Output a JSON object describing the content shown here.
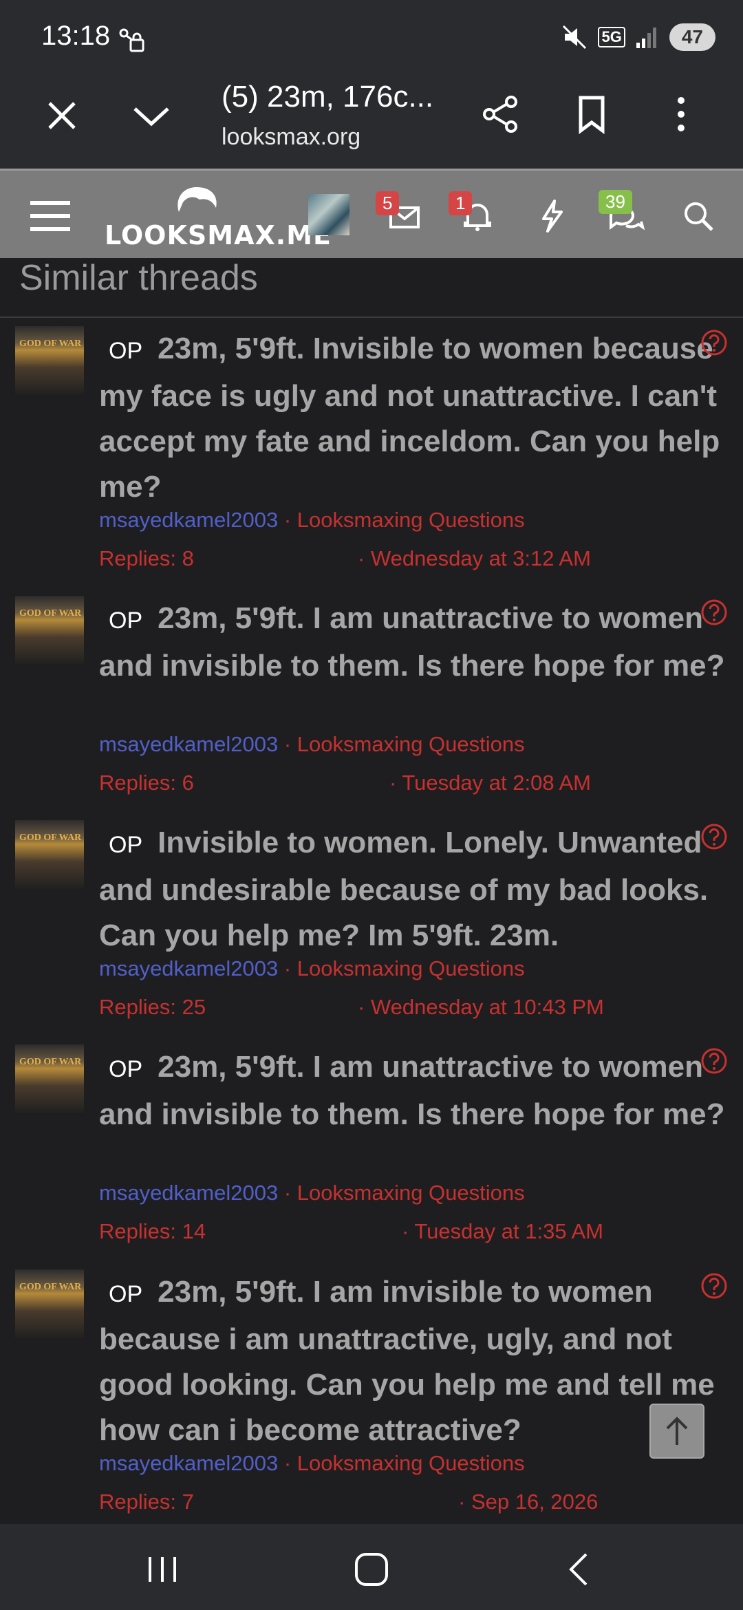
{
  "status_bar": {
    "time": "13:18",
    "network": "5G",
    "battery": "47"
  },
  "browser": {
    "tab_title": "(5) 23m, 176c...",
    "url": "looksmax.org"
  },
  "site_header": {
    "logo_text": "LOOKSMAX.ME",
    "messages_count": "5",
    "alerts_count": "1",
    "chat_count": "39"
  },
  "section_title": "Similar threads",
  "threads": [
    {
      "prefix": "OP",
      "title": "23m, 5'9ft. Invisible to women because my face is ugly and not unattractive. I can't accept my fate and inceldom. Can you help me?",
      "author": "msayedkamel2003",
      "forum": "Looksmaxing Questions",
      "replies": "Replies: 8",
      "date": "Wednesday at 3:12 AM"
    },
    {
      "prefix": "OP",
      "title": "23m, 5'9ft. I am unattractive to women and invisible to them. Is there hope for me?",
      "author": "msayedkamel2003",
      "forum": "Looksmaxing Questions",
      "replies": "Replies: 6",
      "date": "Tuesday at 2:08 AM"
    },
    {
      "prefix": "OP",
      "title": "Invisible to women. Lonely. Unwanted and undesirable because of my bad looks. Can you help me? Im 5'9ft. 23m.",
      "author": "msayedkamel2003",
      "forum": "Looksmaxing Questions",
      "replies": "Replies: 25",
      "date": "Wednesday at 10:43 PM"
    },
    {
      "prefix": "OP",
      "title": "23m, 5'9ft. I am unattractive to women and invisible to them. Is there hope for me?",
      "author": "msayedkamel2003",
      "forum": "Looksmaxing Questions",
      "replies": "Replies: 14",
      "date": "Tuesday at 1:35 AM"
    },
    {
      "prefix": "OP",
      "title": "23m, 5'9ft. I am invisible to women because i am unattractive, ugly, and not good looking. Can you help me and tell me how can i become attractive?",
      "author": "msayedkamel2003",
      "forum": "Looksmaxing Questions",
      "replies": "Replies: 7",
      "date": "Sep 16, 2026"
    }
  ],
  "thumb_caption": "GOD OF WAR",
  "meta_separator": "·"
}
